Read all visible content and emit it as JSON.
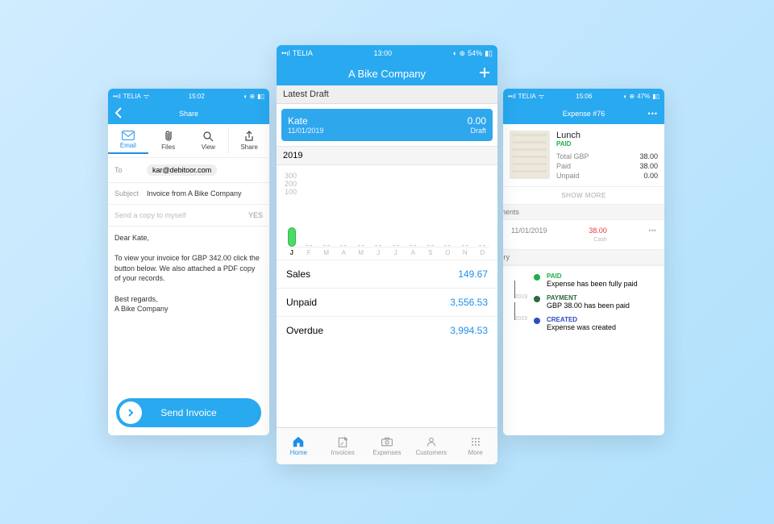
{
  "left": {
    "status": {
      "carrier": "TELIA",
      "time": "15:02",
      "icons": "◐ ⊕",
      "battery": "▮▯"
    },
    "title": "Share",
    "tabs": {
      "email": "Email",
      "files": "Files",
      "view": "View",
      "share": "Share"
    },
    "to_label": "To",
    "to_value": "kar@debitoor.com",
    "subject_label": "Subject",
    "subject_value": "Invoice from A Bike Company",
    "copy_label": "Send a copy to myself",
    "copy_value": "YES",
    "body_greeting": "Dear Kate,",
    "body_main": "To view your invoice for GBP 342.00 click the button below. We also attached a PDF copy of your records.",
    "body_signoff": "Best regards,",
    "body_company": "A Bike Company",
    "send_label": "Send Invoice"
  },
  "center": {
    "status": {
      "carrier": "TELIA",
      "time": "13:00",
      "battery_pct": "54%"
    },
    "title": "A Bike Company",
    "latest_draft": "Latest Draft",
    "draft": {
      "name": "Kate",
      "date": "11/01/2019",
      "amount": "0.00",
      "tag": "Draft"
    },
    "year": "2019",
    "y_ticks": [
      "300",
      "200",
      "100"
    ],
    "months": [
      "J",
      "F",
      "M",
      "A",
      "M",
      "J",
      "J",
      "A",
      "S",
      "O",
      "N",
      "D"
    ],
    "rows": {
      "sales_label": "Sales",
      "sales_val": "149.67",
      "unpaid_label": "Unpaid",
      "unpaid_val": "3,556.53",
      "overdue_label": "Overdue",
      "overdue_val": "3,994.53"
    },
    "tabs": {
      "home": "Home",
      "invoices": "Invoices",
      "expenses": "Expenses",
      "customers": "Customers",
      "more": "More"
    }
  },
  "right": {
    "status": {
      "carrier": "TELIA",
      "time": "15:06",
      "battery_pct": "47%"
    },
    "title": "Expense #76",
    "lunch": "Lunch",
    "paid": "PAID",
    "total_label": "Total GBP",
    "total_val": "38.00",
    "paid_label": "Paid",
    "paid_val": "38.00",
    "unpaid_label": "Unpaid",
    "unpaid_val": "0.00",
    "show_more": "SHOW MORE",
    "payments_section": "Payments",
    "pay_date": "11/01/2019",
    "pay_amount": "38.00",
    "pay_method": "Cash",
    "history_section": "History",
    "tl": [
      {
        "title": "PAID",
        "desc": "Expense has been fully paid",
        "date": "2019"
      },
      {
        "title": "PAYMENT",
        "desc": "GBP 38.00 has been paid",
        "date": "2019"
      },
      {
        "title": "CREATED",
        "desc": "Expense was created",
        "date": "2019"
      }
    ]
  },
  "chart_data": {
    "type": "bar",
    "categories": [
      "J",
      "F",
      "M",
      "A",
      "M",
      "J",
      "J",
      "A",
      "S",
      "O",
      "N",
      "D"
    ],
    "values": [
      120,
      0,
      0,
      0,
      0,
      0,
      0,
      0,
      0,
      0,
      0,
      0
    ],
    "series_name": "Sales",
    "ylim": [
      0,
      300
    ],
    "y_ticks": [
      100,
      200,
      300
    ],
    "year": "2019"
  }
}
